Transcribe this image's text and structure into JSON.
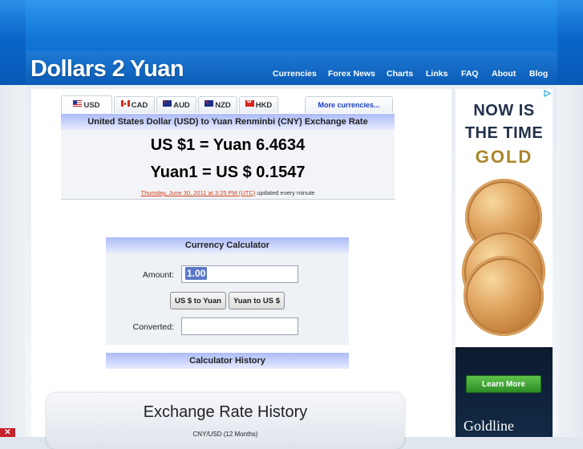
{
  "header": {
    "logo": "Dollars 2 Yuan",
    "nav": [
      "Currencies",
      "Forex News",
      "Charts",
      "Links",
      "FAQ",
      "About",
      "Blog"
    ]
  },
  "tabs": [
    {
      "code": "USD",
      "flag": "us-flag-icon",
      "active": true
    },
    {
      "code": "CAD",
      "flag": "canada-flag-icon",
      "active": false
    },
    {
      "code": "AUD",
      "flag": "australia-flag-icon",
      "active": false
    },
    {
      "code": "NZD",
      "flag": "new-zealand-flag-icon",
      "active": false
    },
    {
      "code": "HKD",
      "flag": "hong-kong-flag-icon",
      "active": false
    }
  ],
  "more_currencies": "More currencies...",
  "rate": {
    "title": "United States Dollar (USD) to Yuan Renminbi (CNY) Exchange Rate",
    "line1": "US $1 = Yuan 6.4634",
    "line2": "Yuan1 = US $ 0.1547",
    "timestamp": "Thursday, June 30, 2011 at 3:25 PM (UTC)",
    "update_note": " updated every minute"
  },
  "calculator": {
    "title": "Currency Calculator",
    "amount_label": "Amount:",
    "amount_value": "1.00",
    "btn_to_yuan": "US $ to Yuan",
    "btn_to_usd": "Yuan to US $",
    "converted_label": "Converted:",
    "converted_value": ""
  },
  "history_bar": "Calculator History",
  "exchange_history": {
    "title": "Exchange Rate History",
    "subtitle": "CNY/USD (12 Months)"
  },
  "ad": {
    "line1": "NOW IS",
    "line2": "THE TIME",
    "line3": "GOLD",
    "button": "Learn More",
    "brand": "Goldline",
    "choices_icon": "adchoices-icon"
  },
  "colors": {
    "header_blue": "#0b66c9",
    "bar_lavender": "#c9d3fb",
    "link_orange": "#d2431f",
    "more_link_blue": "#1d3fbf",
    "ad_green": "#2c8e26"
  }
}
